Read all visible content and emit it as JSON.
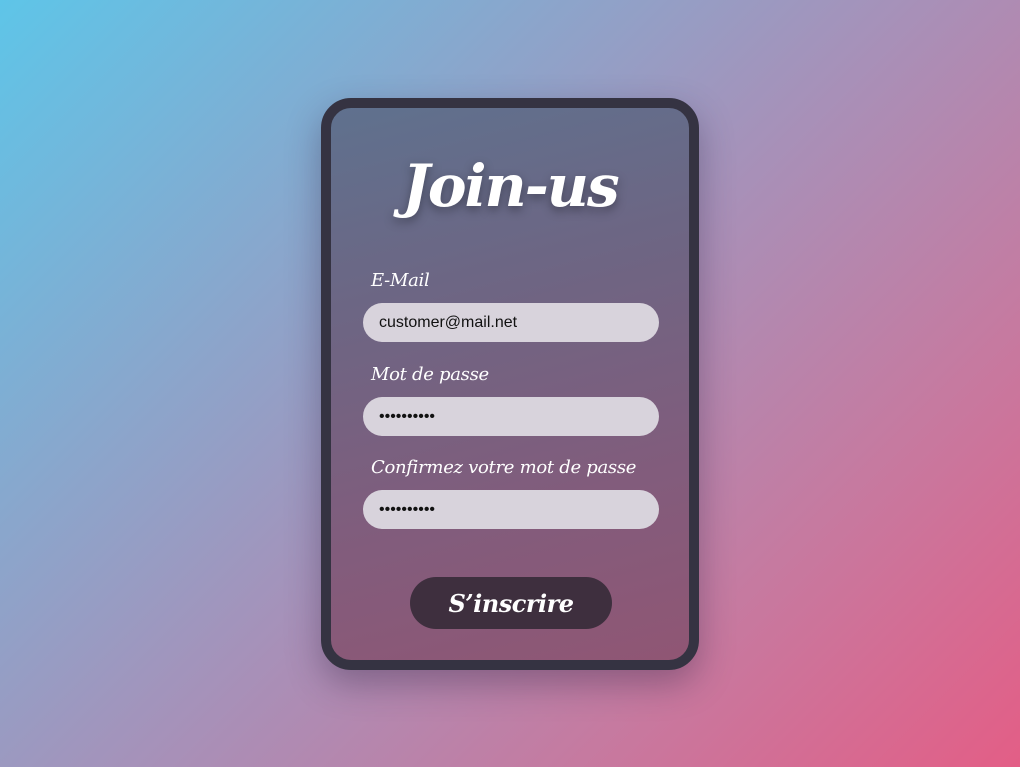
{
  "form": {
    "title": "Join-us",
    "email": {
      "label": "E-Mail",
      "value": "customer@mail.net"
    },
    "password": {
      "label": "Mot de passe",
      "value": "••••••••••"
    },
    "confirm_password": {
      "label": "Confirmez votre mot de passe",
      "value": "••••••••••"
    },
    "submit_label": "S’inscrire"
  },
  "colors": {
    "background_gradient": [
      "#5ec5e8",
      "#a890b8",
      "#e35e86"
    ],
    "card_border": "#353342",
    "input_background": "#d8d3dc",
    "button_background": "#3e2f3e",
    "text": "#ffffff"
  }
}
